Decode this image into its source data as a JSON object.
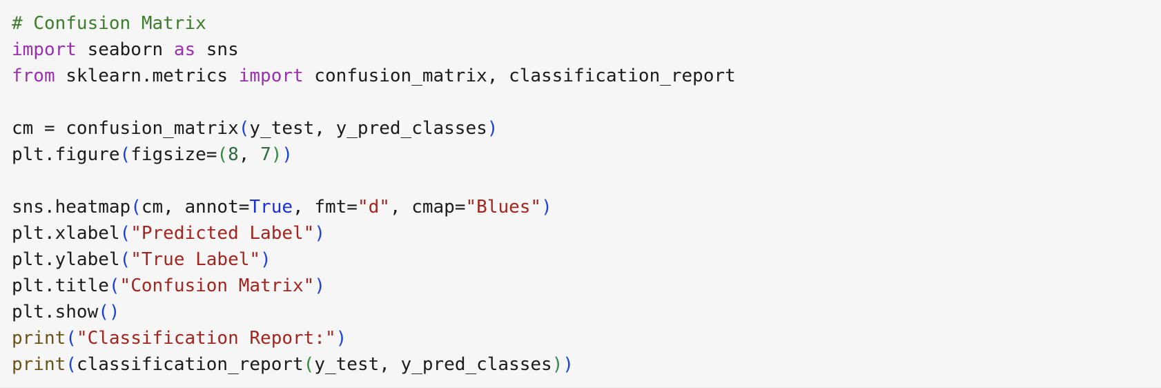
{
  "colors": {
    "background": "#f6f6f6",
    "comment": "#3b7d2a",
    "keyword": "#9b2fb0",
    "plain": "#1b1b1b",
    "paren": "#1a3fe0",
    "paren_nested": "#2e8b3d",
    "number": "#2e6b3e",
    "builtin": "#1a2fd8",
    "string": "#a3251f",
    "func": "#6b5315"
  },
  "code": {
    "lines": [
      [
        {
          "t": "comment",
          "v": "# Confusion Matrix"
        }
      ],
      [
        {
          "t": "keyword",
          "v": "import"
        },
        {
          "t": "plain",
          "v": " seaborn "
        },
        {
          "t": "keyword",
          "v": "as"
        },
        {
          "t": "plain",
          "v": " sns"
        }
      ],
      [
        {
          "t": "keyword",
          "v": "from"
        },
        {
          "t": "plain",
          "v": " sklearn.metrics "
        },
        {
          "t": "keyword",
          "v": "import"
        },
        {
          "t": "plain",
          "v": " confusion_matrix, classification_report"
        }
      ],
      [],
      [
        {
          "t": "plain",
          "v": "cm = confusion_matrix"
        },
        {
          "t": "paren",
          "v": "("
        },
        {
          "t": "plain",
          "v": "y_test, y_pred_classes"
        },
        {
          "t": "paren",
          "v": ")"
        }
      ],
      [
        {
          "t": "plain",
          "v": "plt.figure"
        },
        {
          "t": "paren",
          "v": "("
        },
        {
          "t": "plain",
          "v": "figsize="
        },
        {
          "t": "paren2",
          "v": "("
        },
        {
          "t": "number",
          "v": "8"
        },
        {
          "t": "plain",
          "v": ", "
        },
        {
          "t": "number",
          "v": "7"
        },
        {
          "t": "paren2",
          "v": ")"
        },
        {
          "t": "paren",
          "v": ")"
        }
      ],
      [],
      [
        {
          "t": "plain",
          "v": "sns.heatmap"
        },
        {
          "t": "paren",
          "v": "("
        },
        {
          "t": "plain",
          "v": "cm, annot="
        },
        {
          "t": "builtin",
          "v": "True"
        },
        {
          "t": "plain",
          "v": ", fmt="
        },
        {
          "t": "string",
          "v": "\"d\""
        },
        {
          "t": "plain",
          "v": ", cmap="
        },
        {
          "t": "string",
          "v": "\"Blues\""
        },
        {
          "t": "paren",
          "v": ")"
        }
      ],
      [
        {
          "t": "plain",
          "v": "plt.xlabel"
        },
        {
          "t": "paren",
          "v": "("
        },
        {
          "t": "string",
          "v": "\"Predicted Label\""
        },
        {
          "t": "paren",
          "v": ")"
        }
      ],
      [
        {
          "t": "plain",
          "v": "plt.ylabel"
        },
        {
          "t": "paren",
          "v": "("
        },
        {
          "t": "string",
          "v": "\"True Label\""
        },
        {
          "t": "paren",
          "v": ")"
        }
      ],
      [
        {
          "t": "plain",
          "v": "plt.title"
        },
        {
          "t": "paren",
          "v": "("
        },
        {
          "t": "string",
          "v": "\"Confusion Matrix\""
        },
        {
          "t": "paren",
          "v": ")"
        }
      ],
      [
        {
          "t": "plain",
          "v": "plt.show"
        },
        {
          "t": "paren",
          "v": "()"
        }
      ],
      [
        {
          "t": "func",
          "v": "print"
        },
        {
          "t": "paren",
          "v": "("
        },
        {
          "t": "string",
          "v": "\"Classification Report:\""
        },
        {
          "t": "paren",
          "v": ")"
        }
      ],
      [
        {
          "t": "func",
          "v": "print"
        },
        {
          "t": "paren",
          "v": "("
        },
        {
          "t": "plain",
          "v": "classification_report"
        },
        {
          "t": "paren2",
          "v": "("
        },
        {
          "t": "plain",
          "v": "y_test, y_pred_classes"
        },
        {
          "t": "paren2",
          "v": ")"
        },
        {
          "t": "paren",
          "v": ")"
        }
      ]
    ]
  }
}
